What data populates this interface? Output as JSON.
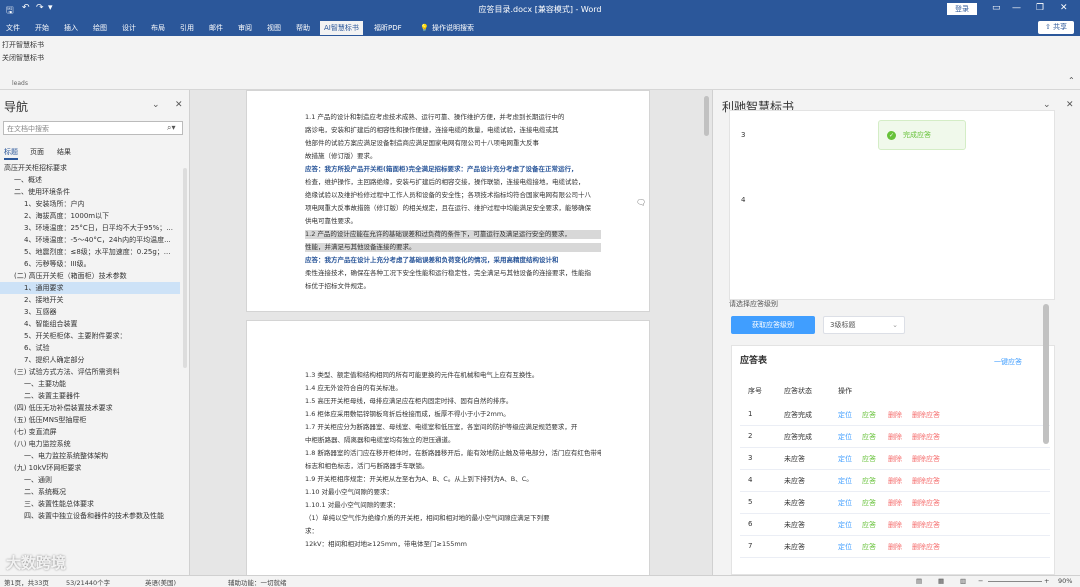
{
  "window": {
    "title": "应答目录.docx [兼容模式] - Word",
    "login_label": "登录"
  },
  "tabs": [
    "文件",
    "开始",
    "插入",
    "绘图",
    "设计",
    "布局",
    "引用",
    "邮件",
    "审阅",
    "视图",
    "帮助",
    "AI智慧标书",
    "福昕PDF",
    "操作说明搜索"
  ],
  "share_label": "共享",
  "ribbon": {
    "open_label": "打开智慧标书",
    "close_label": "关闭智慧标书",
    "group_label": "leads"
  },
  "nav": {
    "title": "导航",
    "search_placeholder": "在文档中搜索",
    "tabs": [
      "标题",
      "页面",
      "结果"
    ],
    "items": [
      {
        "text": "高压开关柜招标要求",
        "level": 0,
        "selected": false
      },
      {
        "text": "一、概述",
        "level": 1,
        "selected": false
      },
      {
        "text": "二、使用环境条件",
        "level": 1,
        "selected": false
      },
      {
        "text": "1、安装场所：户内",
        "level": 2,
        "selected": false
      },
      {
        "text": "2、海拔高度：1000m以下",
        "level": 2,
        "selected": false
      },
      {
        "text": "3、环境温度：25°C日，日平均不大于95%；...",
        "level": 2,
        "selected": false
      },
      {
        "text": "4、环境温度：-5～40°C，24h内的平均温度...",
        "level": 2,
        "selected": false
      },
      {
        "text": "5、地震烈度：≤8级；水平加速度：0.25g；...",
        "level": 2,
        "selected": false
      },
      {
        "text": "6、污秽等级：III级。",
        "level": 2,
        "selected": false
      },
      {
        "text": "(二) 高压开关柜（箱面柜）技术参数",
        "level": 1,
        "selected": false
      },
      {
        "text": "1、通用要求",
        "level": 2,
        "selected": true
      },
      {
        "text": "2、接地开关",
        "level": 2,
        "selected": false
      },
      {
        "text": "3、互感器",
        "level": 2,
        "selected": false
      },
      {
        "text": "4、智能组合装置",
        "level": 2,
        "selected": false
      },
      {
        "text": "5、开关柜柜体、主要附件要求：",
        "level": 2,
        "selected": false
      },
      {
        "text": "6、试验",
        "level": 2,
        "selected": false
      },
      {
        "text": "7、提织人确定部分",
        "level": 2,
        "selected": false
      },
      {
        "text": "(三) 试验方式方法、评估所需资料",
        "level": 1,
        "selected": false
      },
      {
        "text": "一、主要功能",
        "level": 2,
        "selected": false
      },
      {
        "text": "二、装置主要器件",
        "level": 2,
        "selected": false
      },
      {
        "text": "(四) 低压无功补偿装置技术要求",
        "level": 1,
        "selected": false
      },
      {
        "text": "(五) 低压MNS型抽屉柜",
        "level": 1,
        "selected": false
      },
      {
        "text": "(七) 变直流屏",
        "level": 1,
        "selected": false
      },
      {
        "text": "(八) 电力监控系统",
        "level": 1,
        "selected": false
      },
      {
        "text": "一、电力监控系统整体架构",
        "level": 2,
        "selected": false
      },
      {
        "text": "(九) 10kV环网柜要求",
        "level": 1,
        "selected": false
      },
      {
        "text": "一、通则",
        "level": 2,
        "selected": false
      },
      {
        "text": "二、系统概况",
        "level": 2,
        "selected": false
      },
      {
        "text": "三、装置性能总体要求",
        "level": 2,
        "selected": false
      },
      {
        "text": "四、装置中独立设备和器件的技术参数及性能",
        "level": 2,
        "selected": false
      }
    ]
  },
  "doc": {
    "page1": [
      {
        "t": "1.1 产品的设计和制造应考虑技术成熟、运行可靠、操作维护方便，并考虑到长期运行中的",
        "cls": ""
      },
      {
        "t": "路诊电，安装和扩建后的相容性和操作便捷，连接电缆的数量，电缆试验，连接电缆或其",
        "cls": ""
      },
      {
        "t": "他部件的试验方案应满足设备制造商应满足国家电网有限公司十八项电网重大反事",
        "cls": ""
      },
      {
        "t": "故措施（修订版）要求。",
        "cls": ""
      },
      {
        "t": "应答：我方所投产品开关柜(箱面柜)完全满足招标要求：产品设计充分考虑了设备在正常运行，",
        "cls": "blue"
      },
      {
        "t": "检查，维护操作，主回路绝缘，安装与扩建后的相容交接，操作联锁，连接电缆接地，电缆试验，",
        "cls": ""
      },
      {
        "t": "绝缘试验以及维护检修过程中工作人员和设备的安全性；各项技术指标均符合国家电网有限公司十八",
        "cls": ""
      },
      {
        "t": "项电网重大反事故措施（修订版）的相关规定，且在运行、维护过程中均能满足安全要求，能够确保",
        "cls": ""
      },
      {
        "t": "供电可靠性要求。",
        "cls": ""
      },
      {
        "t": "1.2 产品的设计应能在允许的基础误差和过负荷的条件下，可靠运行及满足运行安全的要求，",
        "cls": "hl"
      },
      {
        "t": "性能，并满足与其他设备连接的要求。",
        "cls": "hl"
      },
      {
        "t": "应答：我方产品在设计上充分考虑了基础误差和负荷变化的情况，采用高精度结构设计和",
        "cls": "blue"
      },
      {
        "t": "柔性连接技术，确保在各种工况下安全性能和运行稳定性，完全满足与其他设备的连接要求，性能指",
        "cls": ""
      },
      {
        "t": "标优于招标文件规定。",
        "cls": ""
      }
    ],
    "page2": [
      {
        "t": "1.3 类型、额定值和结构相同的所有可能更换的元件在机械和电气上应有互换性。",
        "cls": ""
      },
      {
        "t": "1.4 应无外设符合自的有关标准。",
        "cls": ""
      },
      {
        "t": "1.5 高压开关柜母线，母排应满足应在柜内固定时排、固有自然的排序。",
        "cls": ""
      },
      {
        "t": "1.6 柜体应采用敷铝锌钢板弯折后栓接而成，板厚不得小于小于2mm。",
        "cls": ""
      },
      {
        "t": "1.7 开关柜应分为断路器室、母线室、电缆室和低压室，各室间的防护等级应满足规范要求，开",
        "cls": ""
      },
      {
        "t": "中柜断路器、隔离器和电缆室均有独立的泄压通道。",
        "cls": ""
      },
      {
        "t": "1.8 断路器室的活门应在移开柜体时，在断路器移开后，能有效地防止触及带电部分，活门应有红色带电",
        "cls": ""
      },
      {
        "t": "标志和相色标志，活门与断路器手车联锁。",
        "cls": ""
      },
      {
        "t": "1.9 开关柜相序规定：开关柜从左至右为A、B、C。从上到下排列为A、B、C。",
        "cls": ""
      },
      {
        "t": "1.10 对最小空气间隙的要求：",
        "cls": ""
      },
      {
        "t": "1.10.1 对最小空气间隙的要求：",
        "cls": ""
      },
      {
        "t": "（1）单纯以空气作为绝缘介质的开关柜，相间和相对地的最小空气间隙应满足下列要",
        "cls": ""
      },
      {
        "t": "求：",
        "cls": ""
      },
      {
        "t": "12kV：相间和相对地≥125mm，带电体至门≥155mm",
        "cls": ""
      }
    ]
  },
  "panel": {
    "title": "利驰智慧标书",
    "toast": "完成应答",
    "card_numbers": [
      "3",
      "4"
    ],
    "level_label": "请选择应答级别",
    "get_button": "获取应答级别",
    "level_value": "3级标题",
    "table_title": "应答表",
    "table_link": "一键应答",
    "columns": [
      "序号",
      "应答状态",
      "操作"
    ],
    "rows": [
      {
        "no": "1",
        "status": "应答完成",
        "a1": "定位",
        "a2": "应答",
        "a3": "删除",
        "a4": "删除应答"
      },
      {
        "no": "2",
        "status": "应答完成",
        "a1": "定位",
        "a2": "应答",
        "a3": "删除",
        "a4": "删除应答"
      },
      {
        "no": "3",
        "status": "未应答",
        "a1": "定位",
        "a2": "应答",
        "a3": "删除",
        "a4": "删除应答"
      },
      {
        "no": "4",
        "status": "未应答",
        "a1": "定位",
        "a2": "应答",
        "a3": "删除",
        "a4": "删除应答"
      },
      {
        "no": "5",
        "status": "未应答",
        "a1": "定位",
        "a2": "应答",
        "a3": "删除",
        "a4": "删除应答"
      },
      {
        "no": "6",
        "status": "未应答",
        "a1": "定位",
        "a2": "应答",
        "a3": "删除",
        "a4": "删除应答"
      },
      {
        "no": "7",
        "status": "未应答",
        "a1": "定位",
        "a2": "应答",
        "a3": "删除",
        "a4": "删除应答"
      }
    ]
  },
  "status": {
    "page": "第1页，共33页",
    "words": "53/21440个字",
    "lang": "英语(美国)",
    "access": "辅助功能：一切就绪",
    "zoom": "90%"
  },
  "watermark": "大数跨境",
  "colors": {
    "word_blue": "#2b579a",
    "accent": "#409eff",
    "success": "#67c23a",
    "danger": "#f56c6c"
  }
}
